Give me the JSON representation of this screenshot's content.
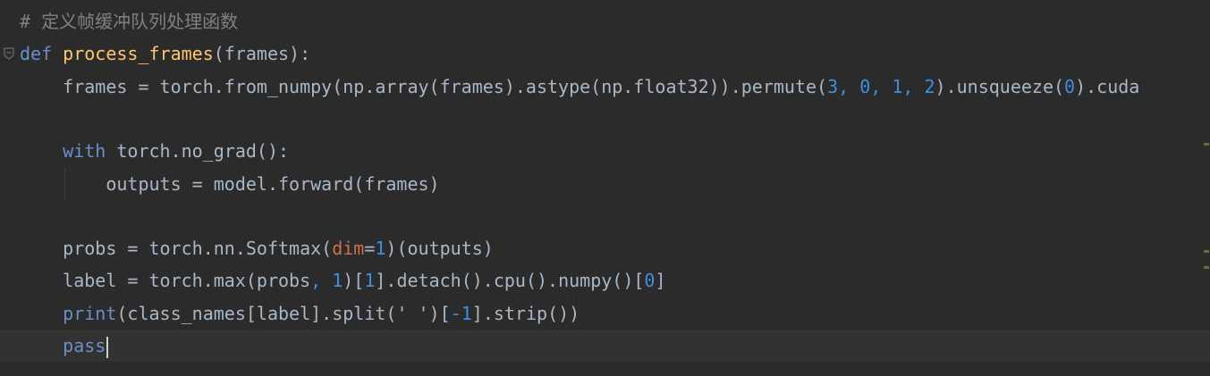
{
  "editor": {
    "lines": [
      {
        "tokens": [
          {
            "t": "# 定义帧缓冲队列处理函数",
            "c": "tok-comment"
          }
        ]
      },
      {
        "tokens": [
          {
            "t": "def",
            "c": "tok-kw2"
          },
          {
            "t": " ",
            "c": "tok-plain"
          },
          {
            "t": "process_frames",
            "c": "tok-fn"
          },
          {
            "t": "(frames):",
            "c": "tok-plain"
          }
        ]
      },
      {
        "tokens": [
          {
            "t": "    frames = torch.from_numpy(np.array(frames).astype(np.float32)).permute(",
            "c": "tok-plain"
          },
          {
            "t": "3",
            "c": "tok-num"
          },
          {
            "t": ", ",
            "c": "tok-comma"
          },
          {
            "t": "0",
            "c": "tok-num"
          },
          {
            "t": ", ",
            "c": "tok-comma"
          },
          {
            "t": "1",
            "c": "tok-num"
          },
          {
            "t": ", ",
            "c": "tok-comma"
          },
          {
            "t": "2",
            "c": "tok-num"
          },
          {
            "t": ").unsqueeze(",
            "c": "tok-plain"
          },
          {
            "t": "0",
            "c": "tok-num"
          },
          {
            "t": ").cuda",
            "c": "tok-plain"
          }
        ]
      },
      {
        "tokens": []
      },
      {
        "tokens": [
          {
            "t": "    ",
            "c": "tok-plain"
          },
          {
            "t": "with",
            "c": "tok-kw2"
          },
          {
            "t": " torch.no_grad():",
            "c": "tok-plain"
          }
        ]
      },
      {
        "tokens": [
          {
            "t": "        outputs = model.forward(frames)",
            "c": "tok-plain"
          }
        ]
      },
      {
        "tokens": []
      },
      {
        "tokens": [
          {
            "t": "    probs = torch.nn.Softmax(",
            "c": "tok-plain"
          },
          {
            "t": "dim",
            "c": "tok-param"
          },
          {
            "t": "=",
            "c": "tok-plain"
          },
          {
            "t": "1",
            "c": "tok-num"
          },
          {
            "t": ")(outputs)",
            "c": "tok-plain"
          }
        ]
      },
      {
        "tokens": [
          {
            "t": "    label = torch.max(probs",
            "c": "tok-plain"
          },
          {
            "t": ", ",
            "c": "tok-comma"
          },
          {
            "t": "1",
            "c": "tok-num"
          },
          {
            "t": ")[",
            "c": "tok-plain"
          },
          {
            "t": "1",
            "c": "tok-num"
          },
          {
            "t": "].detach().cpu().numpy()[",
            "c": "tok-plain"
          },
          {
            "t": "0",
            "c": "tok-num"
          },
          {
            "t": "]",
            "c": "tok-plain"
          }
        ]
      },
      {
        "tokens": [
          {
            "t": "    ",
            "c": "tok-plain"
          },
          {
            "t": "print",
            "c": "tok-kw2"
          },
          {
            "t": "(class_names[label].split(",
            "c": "tok-plain"
          },
          {
            "t": "' '",
            "c": "tok-str"
          },
          {
            "t": ")[",
            "c": "tok-plain"
          },
          {
            "t": "-1",
            "c": "tok-num"
          },
          {
            "t": "].strip())",
            "c": "tok-plain"
          }
        ]
      },
      {
        "tokens": [
          {
            "t": "    ",
            "c": "tok-plain"
          },
          {
            "t": "pass",
            "c": "tok-kw2"
          }
        ]
      }
    ]
  },
  "icons": {
    "fold_open": "fold-open-icon",
    "fold_end": "fold-end-icon"
  },
  "colors": {
    "background": "#2b2b2b",
    "current_line": "#323232",
    "text": "#a9b7c6",
    "keyword": "#6a8fca",
    "function": "#ffc66d",
    "number": "#3d8fe0",
    "param": "#d0704a",
    "comment": "#808080"
  }
}
